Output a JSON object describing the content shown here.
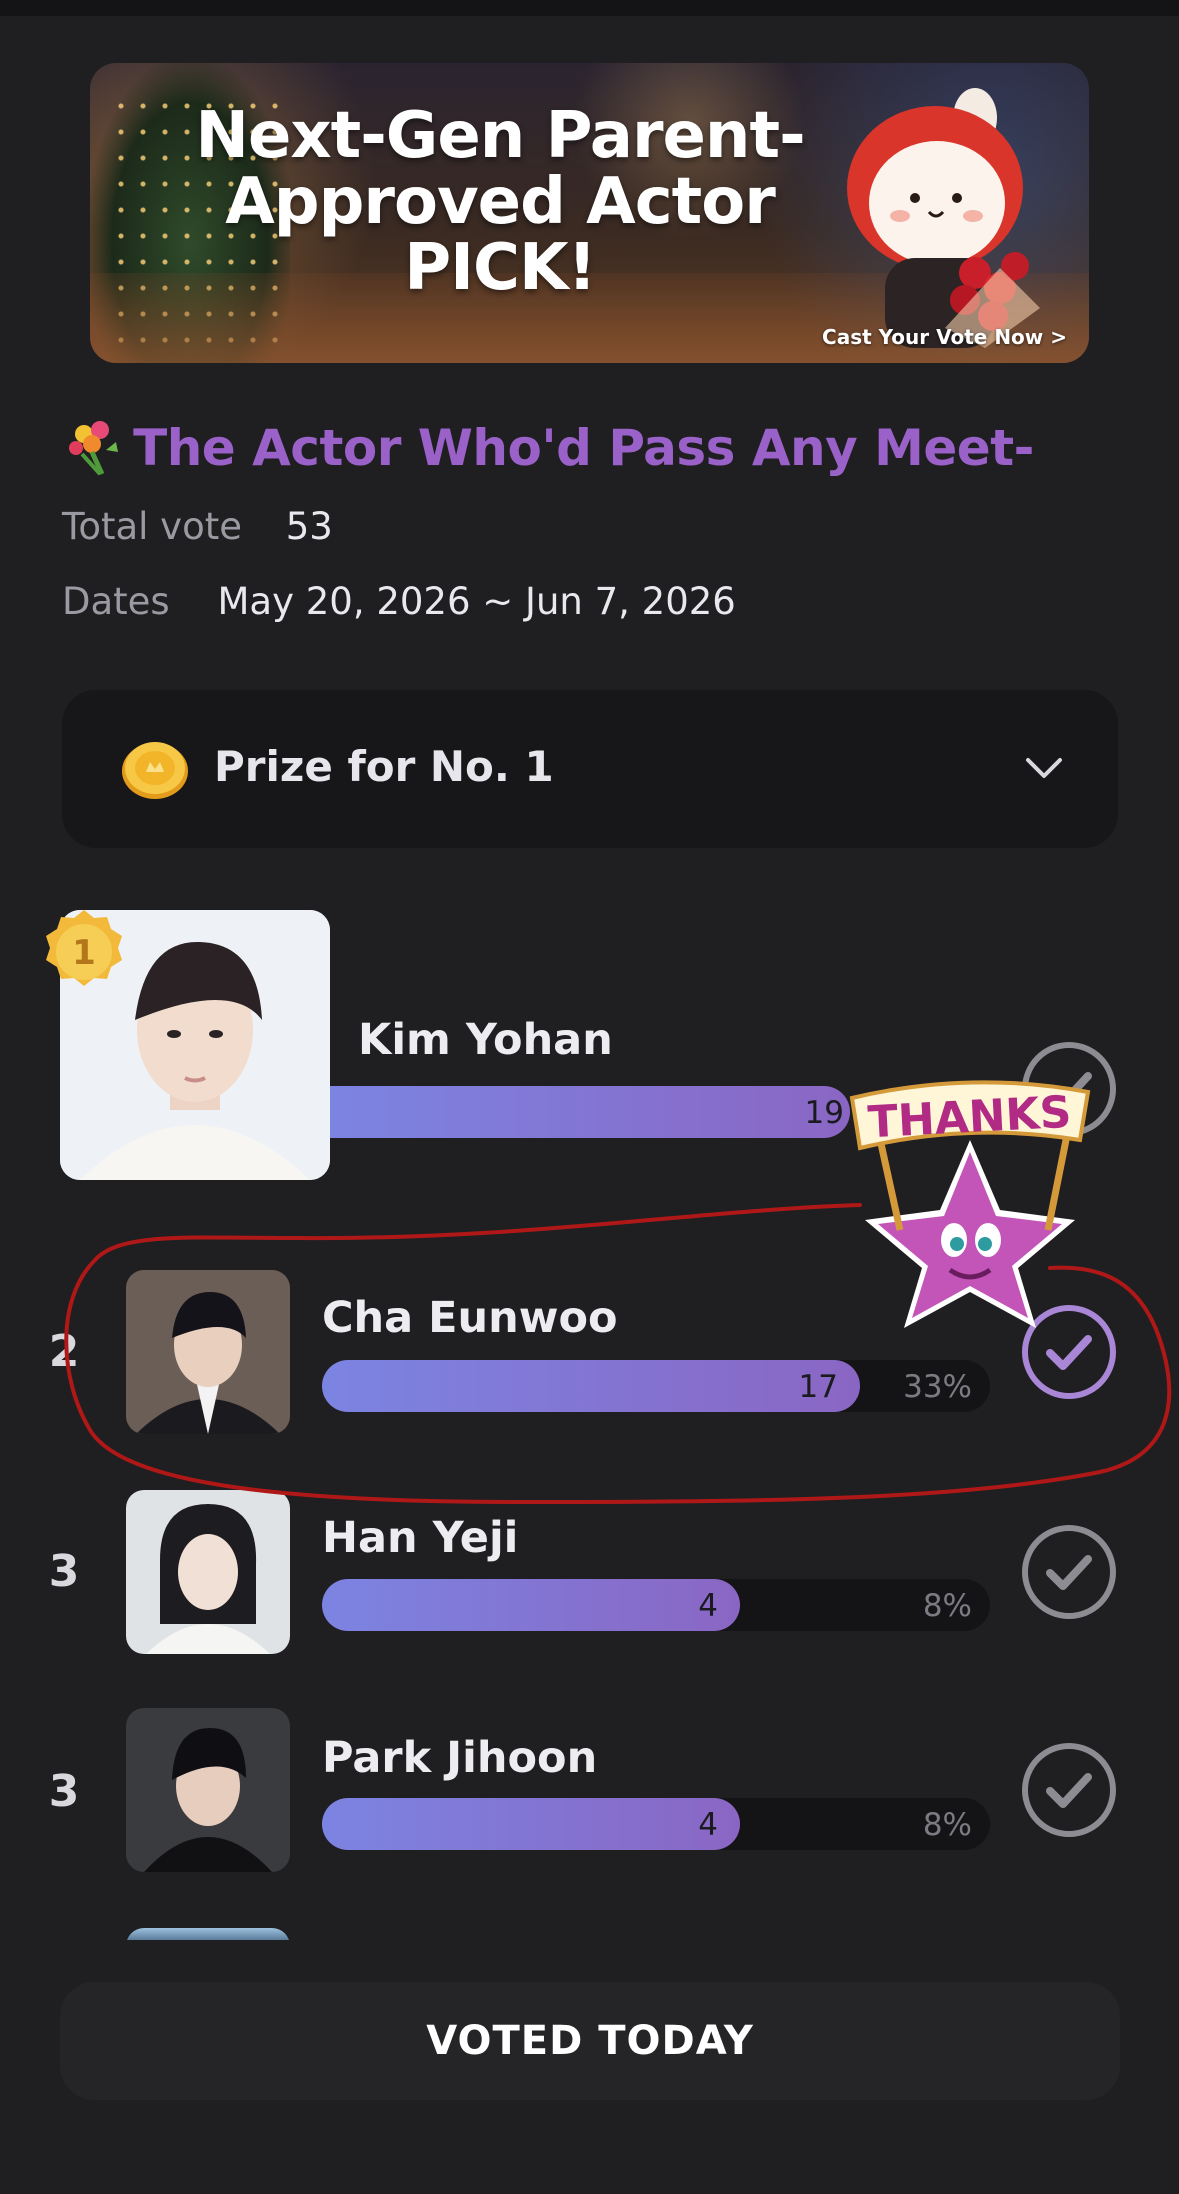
{
  "banner": {
    "title": "Next-Gen Parent-Approved Actor PICK!",
    "cta": "Cast Your Vote Now >"
  },
  "vote": {
    "title": "The Actor Who'd Pass Any Meet-",
    "total_label": "Total vote",
    "total_value": "53",
    "dates_label": "Dates",
    "dates_value": "May 20, 2026 ~ Jun 7, 2026"
  },
  "prize": {
    "label": "Prize for No. 1"
  },
  "candidates": [
    {
      "rank": "1",
      "name": "Kim Yohan",
      "count": "19",
      "percent": "",
      "fill_fraction": 0.36
    },
    {
      "rank": "2",
      "name": "Cha Eunwoo",
      "count": "17",
      "percent": "33%",
      "fill_fraction": 0.33
    },
    {
      "rank": "3",
      "name": "Han Yeji",
      "count": "4",
      "percent": "8%",
      "fill_fraction": 0.08
    },
    {
      "rank": "3",
      "name": "Park Jihoon",
      "count": "4",
      "percent": "8%",
      "fill_fraction": 0.08
    }
  ],
  "sticker": {
    "text": "THANKS"
  },
  "footer": {
    "voted_label": "VOTED TODAY"
  },
  "colors": {
    "accent_purple": "#9a62c9",
    "bar_start": "#7c84e2",
    "bar_end": "#8a66c4",
    "annotation_red": "#b01818"
  },
  "icons": [
    "bouquet-icon",
    "coin-icon",
    "chevron-down-icon",
    "medal-icon",
    "check-icon"
  ]
}
